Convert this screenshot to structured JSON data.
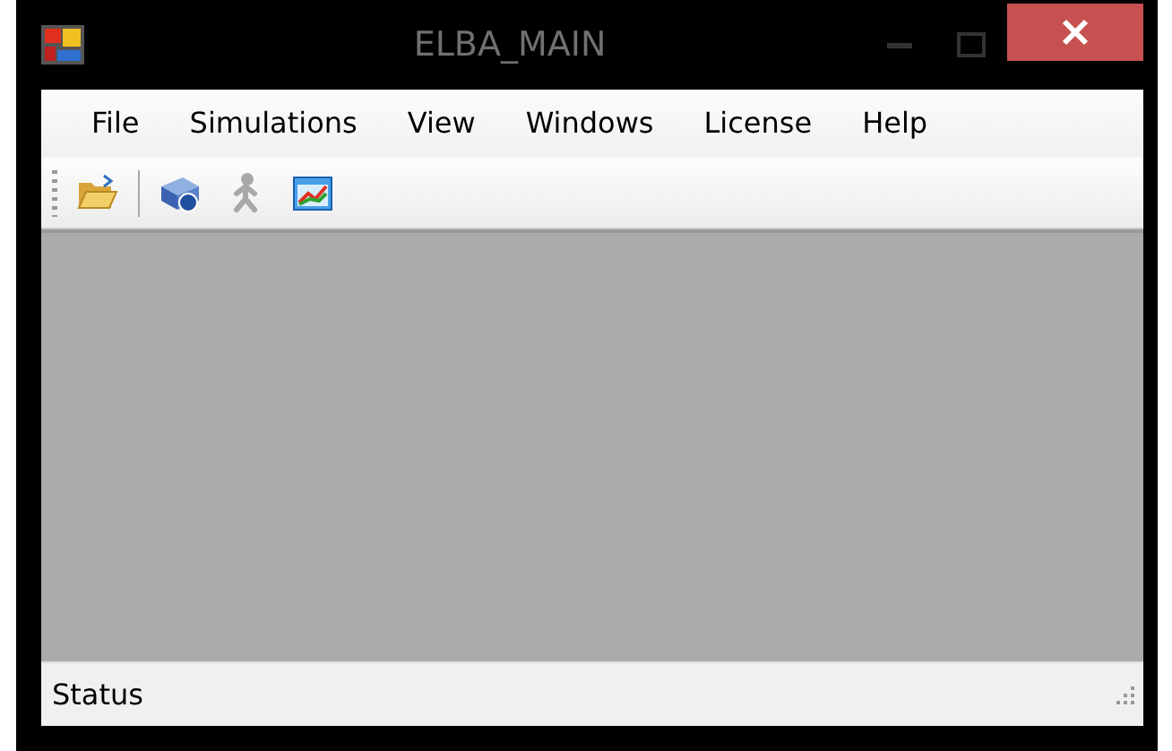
{
  "window": {
    "title": "ELBA_MAIN"
  },
  "menu": [
    "File",
    "Simulations",
    "View",
    "Windows",
    "License",
    "Help"
  ],
  "toolbar": [
    {
      "kind": "open",
      "disabled": false
    },
    {
      "kind": "separator"
    },
    {
      "kind": "help",
      "disabled": false
    },
    {
      "kind": "run",
      "disabled": true
    },
    {
      "kind": "chart",
      "disabled": false
    }
  ],
  "status_bar": {
    "text": "Status"
  }
}
